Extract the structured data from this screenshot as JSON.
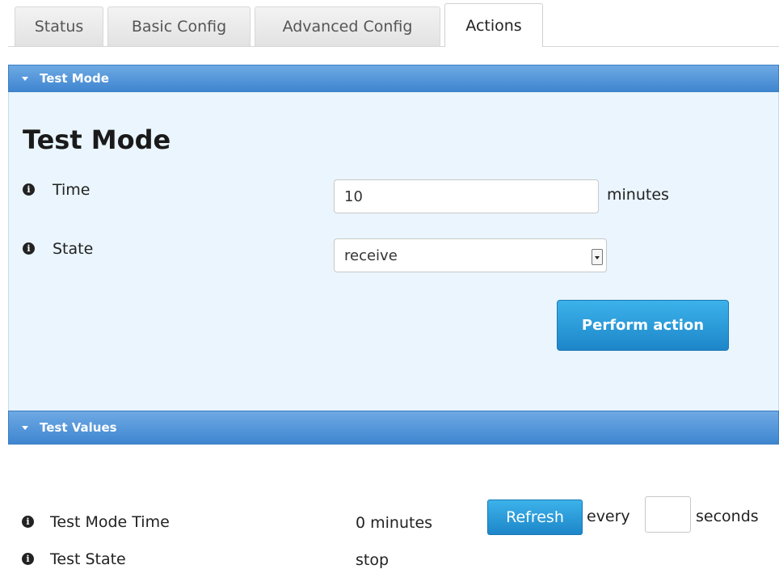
{
  "tabs": [
    {
      "label": "Status"
    },
    {
      "label": "Basic Config"
    },
    {
      "label": "Advanced Config"
    },
    {
      "label": "Actions"
    }
  ],
  "test_mode_panel": {
    "header": "Test Mode",
    "title": "Test Mode",
    "time_label": "Time",
    "time_value": "10",
    "time_unit": "minutes",
    "state_label": "State",
    "state_value": "receive",
    "perform_button": "Perform action"
  },
  "test_values_panel": {
    "header": "Test Values",
    "rows": [
      {
        "label": "Test Mode Time",
        "value": "0 minutes"
      },
      {
        "label": "Test State",
        "value": "stop"
      }
    ],
    "refresh_button": "Refresh",
    "every_label": "every",
    "seconds_value": "",
    "seconds_label": "seconds"
  },
  "colors": {
    "panel_header": "#4a90d9",
    "panel_body": "#eaf5fd",
    "button": "#2a9ad9"
  },
  "icons": {
    "info": "info-icon",
    "collapse": "caret-down-icon"
  }
}
